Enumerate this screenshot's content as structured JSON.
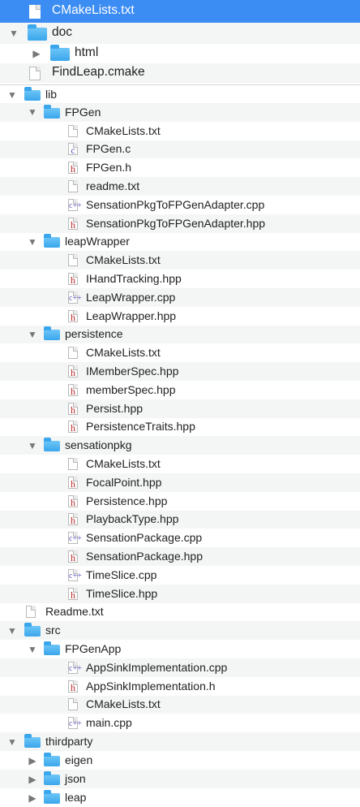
{
  "colors": {
    "selection": "#3b8cf3",
    "stripe": "#f4f5f5",
    "folder": "#3aa6ec",
    "header_glyph": "#b82828",
    "source_glyph": "#5a55b8"
  },
  "icons": {
    "folder": "folder-icon",
    "text_file": "text-file-icon",
    "c_file": "c-file-icon",
    "header_file": "header-file-icon",
    "cpp_file": "cpp-file-icon",
    "expanded": "triangle-down-icon",
    "collapsed": "triangle-right-icon"
  },
  "tree": [
    {
      "label": "CMakeLists.txt",
      "kind": "file",
      "depth": 0,
      "selected": true
    },
    {
      "label": "doc",
      "kind": "folder",
      "depth": 0,
      "expanded": true
    },
    {
      "label": "html",
      "kind": "folder",
      "depth": 1,
      "expanded": false
    },
    {
      "label": "FindLeap.cmake",
      "kind": "file",
      "depth": 0
    },
    {
      "label": "lib",
      "kind": "folder",
      "depth": 0,
      "expanded": true
    },
    {
      "label": "FPGen",
      "kind": "folder",
      "depth": 1,
      "expanded": true
    },
    {
      "label": "CMakeLists.txt",
      "kind": "file",
      "depth": 2
    },
    {
      "label": "FPGen.c",
      "kind": "c",
      "depth": 2
    },
    {
      "label": "FPGen.h",
      "kind": "h",
      "depth": 2
    },
    {
      "label": "readme.txt",
      "kind": "file",
      "depth": 2
    },
    {
      "label": "SensationPkgToFPGenAdapter.cpp",
      "kind": "cpp",
      "depth": 2
    },
    {
      "label": "SensationPkgToFPGenAdapter.hpp",
      "kind": "h",
      "depth": 2
    },
    {
      "label": "leapWrapper",
      "kind": "folder",
      "depth": 1,
      "expanded": true
    },
    {
      "label": "CMakeLists.txt",
      "kind": "file",
      "depth": 2
    },
    {
      "label": "IHandTracking.hpp",
      "kind": "h",
      "depth": 2
    },
    {
      "label": "LeapWrapper.cpp",
      "kind": "cpp",
      "depth": 2
    },
    {
      "label": "LeapWrapper.hpp",
      "kind": "h",
      "depth": 2
    },
    {
      "label": "persistence",
      "kind": "folder",
      "depth": 1,
      "expanded": true
    },
    {
      "label": "CMakeLists.txt",
      "kind": "file",
      "depth": 2
    },
    {
      "label": "IMemberSpec.hpp",
      "kind": "h",
      "depth": 2
    },
    {
      "label": "memberSpec.hpp",
      "kind": "h",
      "depth": 2
    },
    {
      "label": "Persist.hpp",
      "kind": "h",
      "depth": 2
    },
    {
      "label": "PersistenceTraits.hpp",
      "kind": "h",
      "depth": 2
    },
    {
      "label": "sensationpkg",
      "kind": "folder",
      "depth": 1,
      "expanded": true
    },
    {
      "label": "CMakeLists.txt",
      "kind": "file",
      "depth": 2
    },
    {
      "label": "FocalPoint.hpp",
      "kind": "h",
      "depth": 2
    },
    {
      "label": "Persistence.hpp",
      "kind": "h",
      "depth": 2
    },
    {
      "label": "PlaybackType.hpp",
      "kind": "h",
      "depth": 2
    },
    {
      "label": "SensationPackage.cpp",
      "kind": "cpp",
      "depth": 2
    },
    {
      "label": "SensationPackage.hpp",
      "kind": "h",
      "depth": 2
    },
    {
      "label": "TimeSlice.cpp",
      "kind": "cpp",
      "depth": 2
    },
    {
      "label": "TimeSlice.hpp",
      "kind": "h",
      "depth": 2
    },
    {
      "label": "Readme.txt",
      "kind": "file",
      "depth": 0
    },
    {
      "label": "src",
      "kind": "folder",
      "depth": 0,
      "expanded": true
    },
    {
      "label": "FPGenApp",
      "kind": "folder",
      "depth": 1,
      "expanded": true
    },
    {
      "label": "AppSinkImplementation.cpp",
      "kind": "cpp",
      "depth": 2
    },
    {
      "label": "AppSinkImplementation.h",
      "kind": "h",
      "depth": 2
    },
    {
      "label": "CMakeLists.txt",
      "kind": "file",
      "depth": 2
    },
    {
      "label": "main.cpp",
      "kind": "cpp",
      "depth": 2
    },
    {
      "label": "thirdparty",
      "kind": "folder",
      "depth": 0,
      "expanded": true
    },
    {
      "label": "eigen",
      "kind": "folder",
      "depth": 1,
      "expanded": false
    },
    {
      "label": "json",
      "kind": "folder",
      "depth": 1,
      "expanded": false
    },
    {
      "label": "leap",
      "kind": "folder",
      "depth": 1,
      "expanded": false
    }
  ]
}
